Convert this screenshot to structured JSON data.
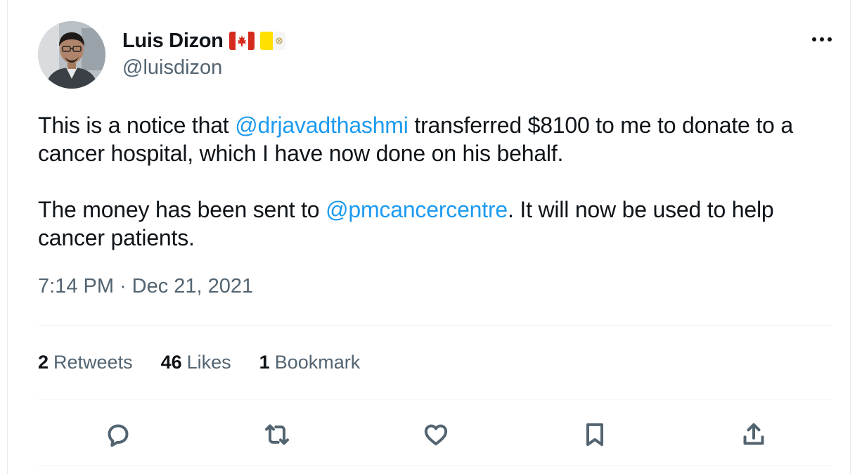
{
  "author": {
    "display_name": "Luis Dizon",
    "handle": "@luisdizon",
    "flags": [
      "canada-flag-icon",
      "vatican-flag-icon"
    ]
  },
  "tweet": {
    "paragraph1": {
      "before": "This is a notice that ",
      "mention": "@drjavadthashmi",
      "after": " transferred $8100 to me to donate to a cancer hospital, which I have now done on his behalf."
    },
    "paragraph2": {
      "before": "The money has been sent to ",
      "mention": "@pmcancercentre",
      "after": ". It will now be used to help cancer patients."
    }
  },
  "meta": {
    "time": "7:14 PM",
    "separator": "·",
    "date": "Dec 21, 2021"
  },
  "stats": {
    "retweets": {
      "count": "2",
      "label": "Retweets"
    },
    "likes": {
      "count": "46",
      "label": "Likes"
    },
    "bookmarks": {
      "count": "1",
      "label": "Bookmark"
    }
  },
  "actions": [
    "reply-icon",
    "retweet-icon",
    "like-icon",
    "bookmark-icon",
    "share-icon"
  ],
  "colors": {
    "mention": "#1d9bf0",
    "secondary_text": "#536471",
    "primary_text": "#0f1419",
    "divider": "#eff3f4"
  }
}
